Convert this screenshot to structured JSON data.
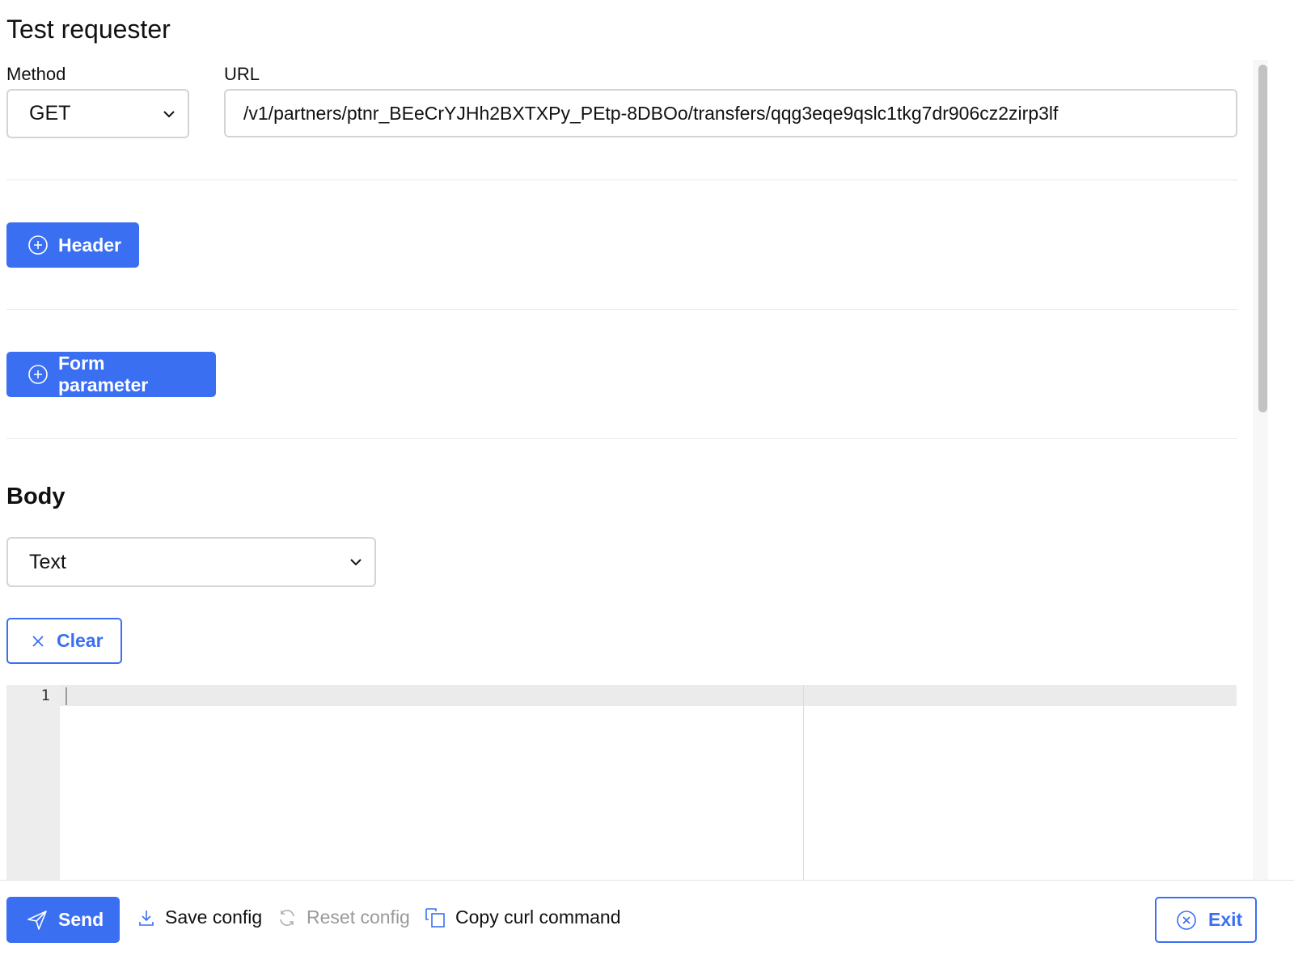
{
  "page": {
    "title": "Test requester"
  },
  "request": {
    "method_label": "Method",
    "method_value": "GET",
    "url_label": "URL",
    "url_value": "/v1/partners/ptnr_BEeCrYJHh2BXTXPy_PEtp-8DBOo/transfers/qqg3eqe9qslc1tkg7dr906cz2zirp3lf"
  },
  "actions": {
    "header_button": "Header",
    "form_parameter_button": "Form parameter"
  },
  "body": {
    "heading": "Body",
    "type_value": "Text",
    "clear_button": "Clear",
    "editor": {
      "line_numbers": [
        "1"
      ],
      "content": ""
    }
  },
  "footer": {
    "send_button": "Send",
    "save_config": "Save config",
    "reset_config": "Reset config",
    "copy_curl": "Copy curl command",
    "exit_button": "Exit"
  },
  "colors": {
    "primary": "#3b6ff2",
    "disabled_text": "#9a9a9a",
    "border": "#d4d4d4"
  },
  "icons": [
    "chevron-down-icon",
    "plus-circle-icon",
    "close-icon",
    "send-icon",
    "download-icon",
    "refresh-icon",
    "copy-icon",
    "close-circle-icon"
  ]
}
